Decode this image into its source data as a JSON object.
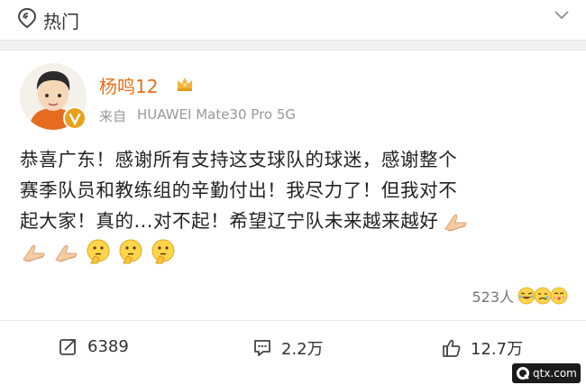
{
  "topbar": {
    "title": "热门"
  },
  "user": {
    "name": "杨鸣12",
    "source_prefix": "来自",
    "source_device": "HUAWEI Mate30 Pro 5G"
  },
  "post": {
    "lines": [
      "恭喜广东！感谢所有支持这支球队的球迷，感谢整个",
      "赛季队员和教练组的辛勤付出！我尽力了！但我对不",
      "起大家！真的...对不起！希望辽宁队未来越来越好"
    ],
    "trailing_emoji_line1": [
      "pray-icon"
    ],
    "emoji_line": [
      "pray-icon",
      "pray-icon",
      "thinking-icon",
      "thinking-icon",
      "thinking-icon"
    ]
  },
  "reactions": {
    "count": "523人",
    "emojis": [
      "laugh-cry-icon",
      "tired-icon",
      "kiss-icon"
    ]
  },
  "actions": {
    "repost": "6389",
    "comment": "2.2万",
    "like": "12.7万"
  },
  "watermark": {
    "text": "qtx.com"
  },
  "colors": {
    "username": "#e8701a",
    "verified": "#e8a21a",
    "muted": "#999999",
    "divider": "#e6e6e6"
  }
}
